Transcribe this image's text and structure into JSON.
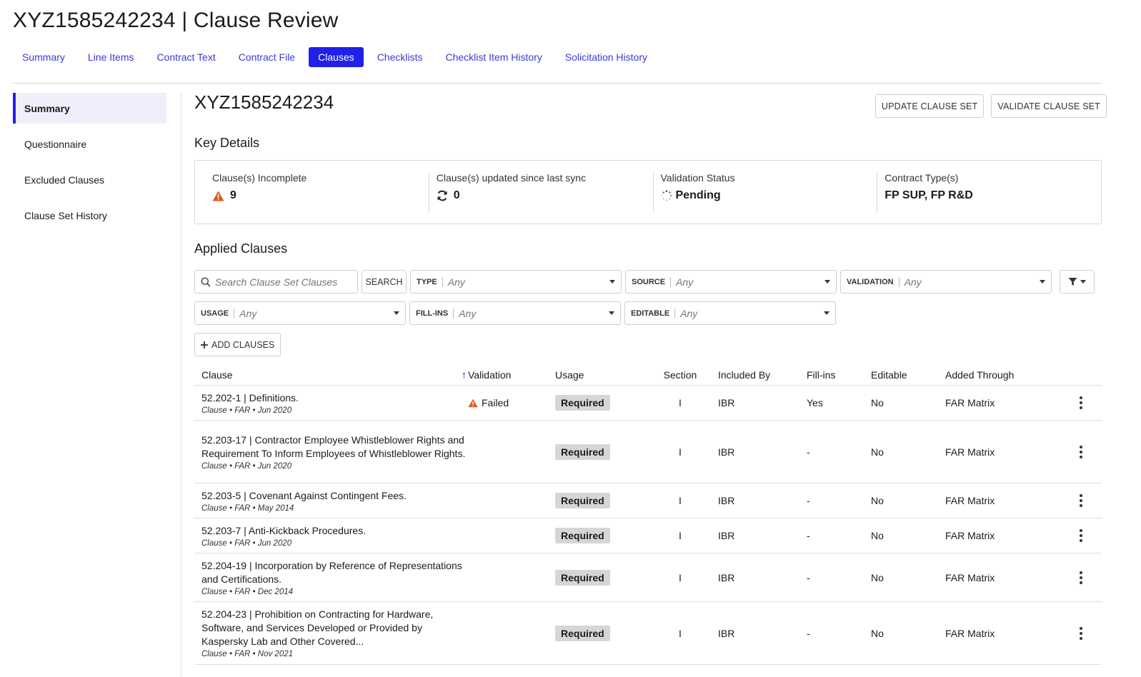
{
  "page": {
    "title": "XYZ1585242234 | Clause Review"
  },
  "tabs": [
    {
      "label": "Summary"
    },
    {
      "label": "Line Items"
    },
    {
      "label": "Contract Text"
    },
    {
      "label": "Contract File"
    },
    {
      "label": "Clauses",
      "active": true
    },
    {
      "label": "Checklists"
    },
    {
      "label": "Checklist Item History"
    },
    {
      "label": "Solicitation History"
    }
  ],
  "sidenav": [
    {
      "label": "Summary",
      "active": true
    },
    {
      "label": "Questionnaire"
    },
    {
      "label": "Excluded Clauses"
    },
    {
      "label": "Clause Set History"
    }
  ],
  "header": {
    "contract_id": "XYZ1585242234",
    "update_btn": "UPDATE CLAUSE SET",
    "validate_btn": "VALIDATE CLAUSE SET"
  },
  "key_details": {
    "heading": "Key Details",
    "incomplete_label": "Clause(s) Incomplete",
    "incomplete_value": "9",
    "updated_label": "Clause(s) updated since last sync",
    "updated_value": "0",
    "validation_label": "Validation Status",
    "validation_value": "Pending",
    "contract_types_label": "Contract Type(s)",
    "contract_types_value": "FP SUP, FP R&D"
  },
  "applied": {
    "heading": "Applied Clauses",
    "search_placeholder": "Search Clause Set Clauses",
    "search_btn": "SEARCH",
    "add_btn": "ADD CLAUSES",
    "filters": {
      "type": {
        "label": "TYPE",
        "value": "Any"
      },
      "source": {
        "label": "SOURCE",
        "value": "Any"
      },
      "validation": {
        "label": "VALIDATION",
        "value": "Any"
      },
      "usage": {
        "label": "USAGE",
        "value": "Any"
      },
      "fillins": {
        "label": "FILL-INS",
        "value": "Any"
      },
      "editable": {
        "label": "EDITABLE",
        "value": "Any"
      }
    }
  },
  "table": {
    "columns": {
      "clause": "Clause",
      "validation": "Validation",
      "usage": "Usage",
      "section": "Section",
      "included_by": "Included By",
      "fillins": "Fill-ins",
      "editable": "Editable",
      "added_through": "Added Through"
    },
    "rows": [
      {
        "title": "52.202-1 | Definitions.",
        "meta": "Clause • FAR • Jun 2020",
        "validation": "Failed",
        "usage": "Required",
        "section": "I",
        "included_by": "IBR",
        "fillins": "Yes",
        "editable": "No",
        "added_through": "FAR Matrix",
        "height": 49
      },
      {
        "title": "52.203-17 | Contractor Employee Whistleblower Rights and Requirement To Inform Employees of Whistleblower Rights.",
        "meta": "Clause • FAR • Jun 2020",
        "validation": "",
        "usage": "Required",
        "section": "I",
        "included_by": "IBR",
        "fillins": "-",
        "editable": "No",
        "added_through": "FAR Matrix",
        "height": 88
      },
      {
        "title": "52.203-5 | Covenant Against Contingent Fees.",
        "meta": "Clause • FAR • May 2014",
        "validation": "",
        "usage": "Required",
        "section": "I",
        "included_by": "IBR",
        "fillins": "-",
        "editable": "No",
        "added_through": "FAR Matrix",
        "height": 49
      },
      {
        "title": "52.203-7 | Anti-Kickback Procedures.",
        "meta": "Clause • FAR • Jun 2020",
        "validation": "",
        "usage": "Required",
        "section": "I",
        "included_by": "IBR",
        "fillins": "-",
        "editable": "No",
        "added_through": "FAR Matrix",
        "height": 49
      },
      {
        "title": "52.204-19 | Incorporation by Reference of Representations and Certifications.",
        "meta": "Clause • FAR • Dec 2014",
        "validation": "",
        "usage": "Required",
        "section": "I",
        "included_by": "IBR",
        "fillins": "-",
        "editable": "No",
        "added_through": "FAR Matrix",
        "height": 68
      },
      {
        "title": "52.204-23 | Prohibition on Contracting for Hardware, Software, and Services Developed or Provided by Kaspersky Lab and Other Covered...",
        "meta": "Clause • FAR • Nov 2021",
        "validation": "",
        "usage": "Required",
        "section": "I",
        "included_by": "IBR",
        "fillins": "-",
        "editable": "No",
        "added_through": "FAR Matrix",
        "height": 88
      }
    ]
  }
}
